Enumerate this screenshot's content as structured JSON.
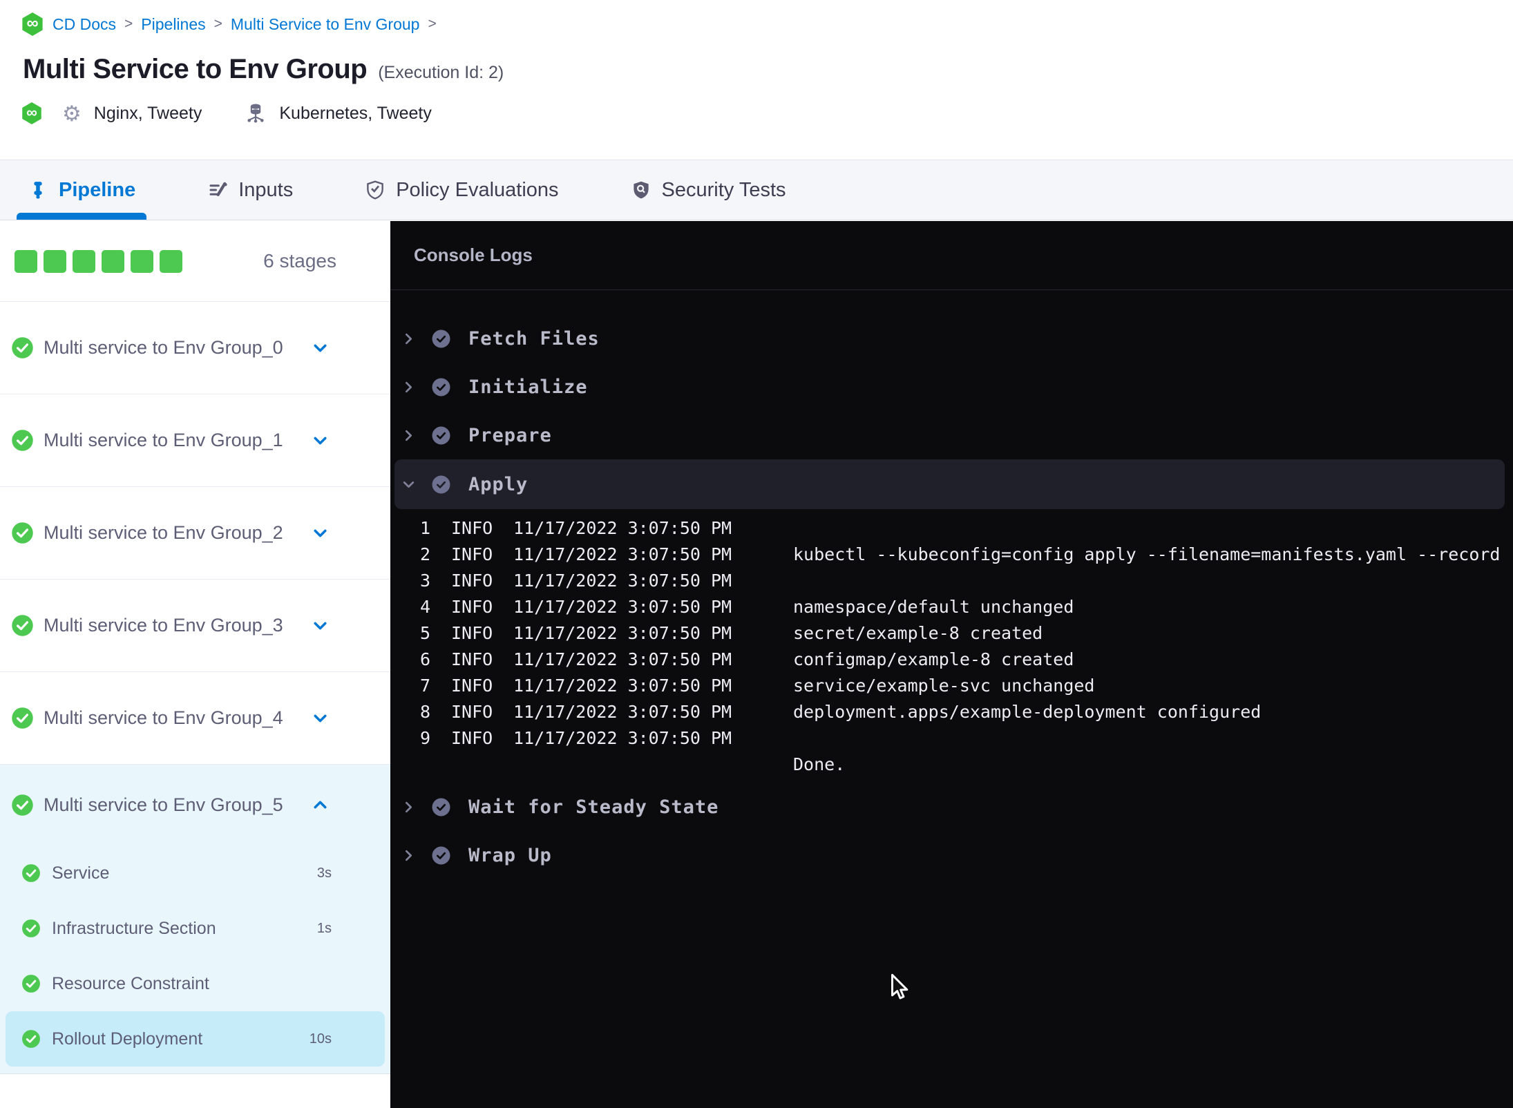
{
  "breadcrumb": {
    "separator": ">",
    "items": [
      {
        "label": "CD Docs"
      },
      {
        "label": "Pipelines"
      },
      {
        "label": "Multi Service to Env Group"
      }
    ]
  },
  "header": {
    "title": "Multi Service to Env Group",
    "execution_id": "(Execution Id: 2)",
    "services_label": "Nginx, Tweety",
    "environments_label": "Kubernetes, Tweety"
  },
  "tabs": {
    "pipeline": "Pipeline",
    "inputs": "Inputs",
    "policy": "Policy Evaluations",
    "security": "Security Tests"
  },
  "stages_panel": {
    "count_label": "6 stages",
    "summary_squares": [
      {},
      {},
      {},
      {},
      {},
      {}
    ],
    "collapsed_stages": [
      {
        "name": "Multi service to Env Group_0"
      },
      {
        "name": "Multi service to Env Group_1"
      },
      {
        "name": "Multi service to Env Group_2"
      },
      {
        "name": "Multi service to Env Group_3"
      },
      {
        "name": "Multi service to Env Group_4"
      }
    ],
    "expanded_stage": {
      "name": "Multi service to Env Group_5",
      "steps": [
        {
          "name": "Service",
          "duration": "3s"
        },
        {
          "name": "Infrastructure Section",
          "duration": "1s"
        },
        {
          "name": "Resource Constraint",
          "duration": ""
        },
        {
          "name": "Rollout Deployment",
          "duration": "10s",
          "selected": true
        }
      ]
    }
  },
  "console": {
    "title": "Console Logs",
    "steps_before": [
      {
        "name": "Fetch Files"
      },
      {
        "name": "Initialize"
      },
      {
        "name": "Prepare"
      }
    ],
    "expanded_step": {
      "name": "Apply"
    },
    "logs": [
      {
        "n": "1",
        "level": "INFO",
        "ts": "11/17/2022 3:07:50 PM",
        "msg": ""
      },
      {
        "n": "2",
        "level": "INFO",
        "ts": "11/17/2022 3:07:50 PM",
        "msg": "kubectl --kubeconfig=config apply --filename=manifests.yaml --record"
      },
      {
        "n": "3",
        "level": "INFO",
        "ts": "11/17/2022 3:07:50 PM",
        "msg": ""
      },
      {
        "n": "4",
        "level": "INFO",
        "ts": "11/17/2022 3:07:50 PM",
        "msg": "namespace/default unchanged"
      },
      {
        "n": "5",
        "level": "INFO",
        "ts": "11/17/2022 3:07:50 PM",
        "msg": "secret/example-8 created"
      },
      {
        "n": "6",
        "level": "INFO",
        "ts": "11/17/2022 3:07:50 PM",
        "msg": "configmap/example-8 created"
      },
      {
        "n": "7",
        "level": "INFO",
        "ts": "11/17/2022 3:07:50 PM",
        "msg": "service/example-svc unchanged"
      },
      {
        "n": "8",
        "level": "INFO",
        "ts": "11/17/2022 3:07:50 PM",
        "msg": "deployment.apps/example-deployment configured"
      },
      {
        "n": "9",
        "level": "INFO",
        "ts": "11/17/2022 3:07:50 PM",
        "msg": ""
      },
      {
        "n": "",
        "level": "",
        "ts": "",
        "msg": "Done."
      }
    ],
    "steps_after": [
      {
        "name": "Wait for Steady State"
      },
      {
        "name": "Wrap Up"
      }
    ]
  },
  "colors": {
    "accent_blue": "#0278d5",
    "success_green": "#4dc952",
    "console_bg": "#0b0b0e",
    "expanded_stage_bg": "#e9f6fc",
    "selected_step_bg": "#c6ecf9"
  }
}
